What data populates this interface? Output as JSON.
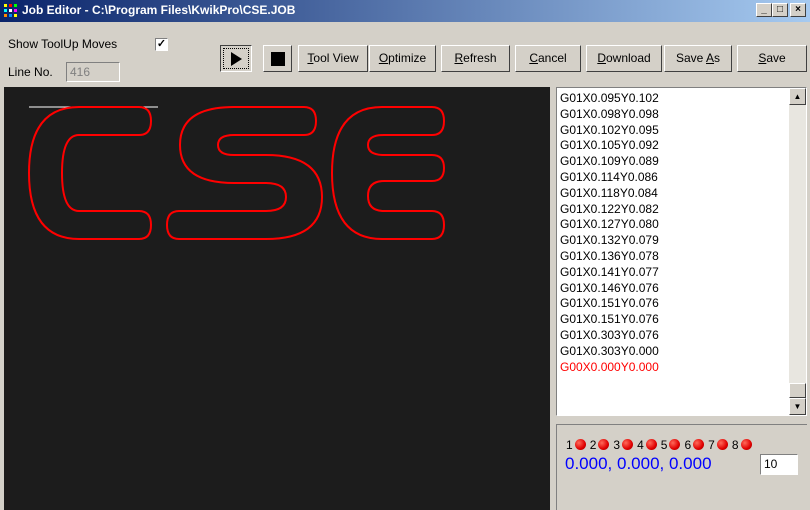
{
  "window": {
    "title": "Job Editor - C:\\Program Files\\KwikPro\\CSE.JOB"
  },
  "controls": {
    "show_toolup_label": "Show ToolUp Moves",
    "show_toolup_checked": "✓",
    "line_no_label": "Line No.",
    "line_no_value": "416"
  },
  "toolbar": {
    "play_icon": "play-icon",
    "stop_icon": "stop-icon",
    "tool_view": {
      "hot": "T",
      "rest": "ool View"
    },
    "optimize": {
      "hot": "O",
      "rest": "ptimize"
    },
    "refresh": {
      "hot": "R",
      "rest": "efresh"
    },
    "cancel": {
      "hot": "C",
      "rest": "ancel"
    },
    "download": {
      "hot": "D",
      "rest": "ownload"
    },
    "save_as": {
      "pre": "Save ",
      "hot": "A",
      "rest": "s"
    },
    "save": {
      "hot": "S",
      "rest": "ave"
    }
  },
  "gcode_lines": [
    "G01X0.095Y0.102",
    "G01X0.098Y0.098",
    "G01X0.102Y0.095",
    "G01X0.105Y0.092",
    "G01X0.109Y0.089",
    "G01X0.114Y0.086",
    "G01X0.118Y0.084",
    "G01X0.122Y0.082",
    "G01X0.127Y0.080",
    "G01X0.132Y0.079",
    "G01X0.136Y0.078",
    "G01X0.141Y0.077",
    "G01X0.146Y0.076",
    "G01X0.151Y0.076",
    "G01X0.151Y0.076",
    "G01X0.303Y0.076",
    "G01X0.303Y0.000",
    "G00X0.000Y0.000"
  ],
  "current_line_index": 17,
  "outputs": [
    "1",
    "2",
    "3",
    "4",
    "5",
    "6",
    "7",
    "8"
  ],
  "position_readout": "0.000, 0.000, 0.000",
  "step_value": "10",
  "colors": {
    "toolpath": "#ff0000",
    "toolup": "#ffffff",
    "canvas": "#1c1c1c",
    "readout": "#0000ff"
  }
}
